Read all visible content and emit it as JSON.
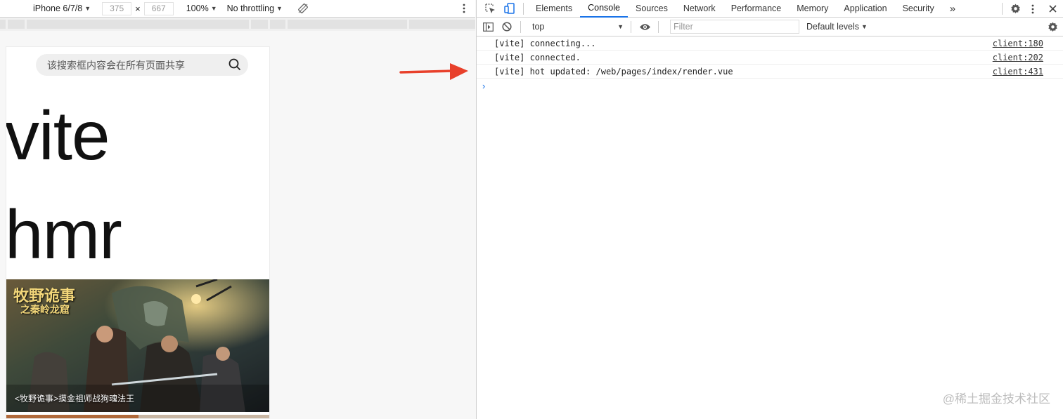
{
  "emulation_toolbar": {
    "device": "iPhone 6/7/8",
    "width": "375",
    "times": "×",
    "height": "667",
    "zoom": "100%",
    "throttling": "No throttling"
  },
  "phone": {
    "search_placeholder": "该搜索框内容会在所有页面共享",
    "heading_1": "vite",
    "heading_2": "hmr",
    "poster": {
      "title": "牧野诡事",
      "subtitle": "之秦岭龙窟",
      "caption": "<牧野诡事>摸金祖师战狗魂法王"
    }
  },
  "devtools": {
    "tabs": [
      "Elements",
      "Console",
      "Sources",
      "Network",
      "Performance",
      "Memory",
      "Application",
      "Security"
    ],
    "active_tab": "Console",
    "more_tabs": "»",
    "context": "top",
    "filter_placeholder": "Filter",
    "levels": "Default levels",
    "logs": [
      {
        "message": "[vite] connecting...",
        "source": "client:180"
      },
      {
        "message": "[vite] connected.",
        "source": "client:202"
      },
      {
        "message": "[vite] hot updated: /web/pages/index/render.vue",
        "source": "client:431"
      }
    ],
    "prompt": "›"
  },
  "watermark": "@稀土掘金技术社区",
  "colors": {
    "accent": "#1a73e8",
    "arrow": "#e8402b"
  },
  "icons": [
    "inspect-icon",
    "device-toggle-icon",
    "rotate-icon",
    "kebab-menu-icon",
    "sidebar-toggle-icon",
    "clear-console-icon",
    "eye-icon",
    "gear-icon",
    "close-icon",
    "search-icon"
  ]
}
